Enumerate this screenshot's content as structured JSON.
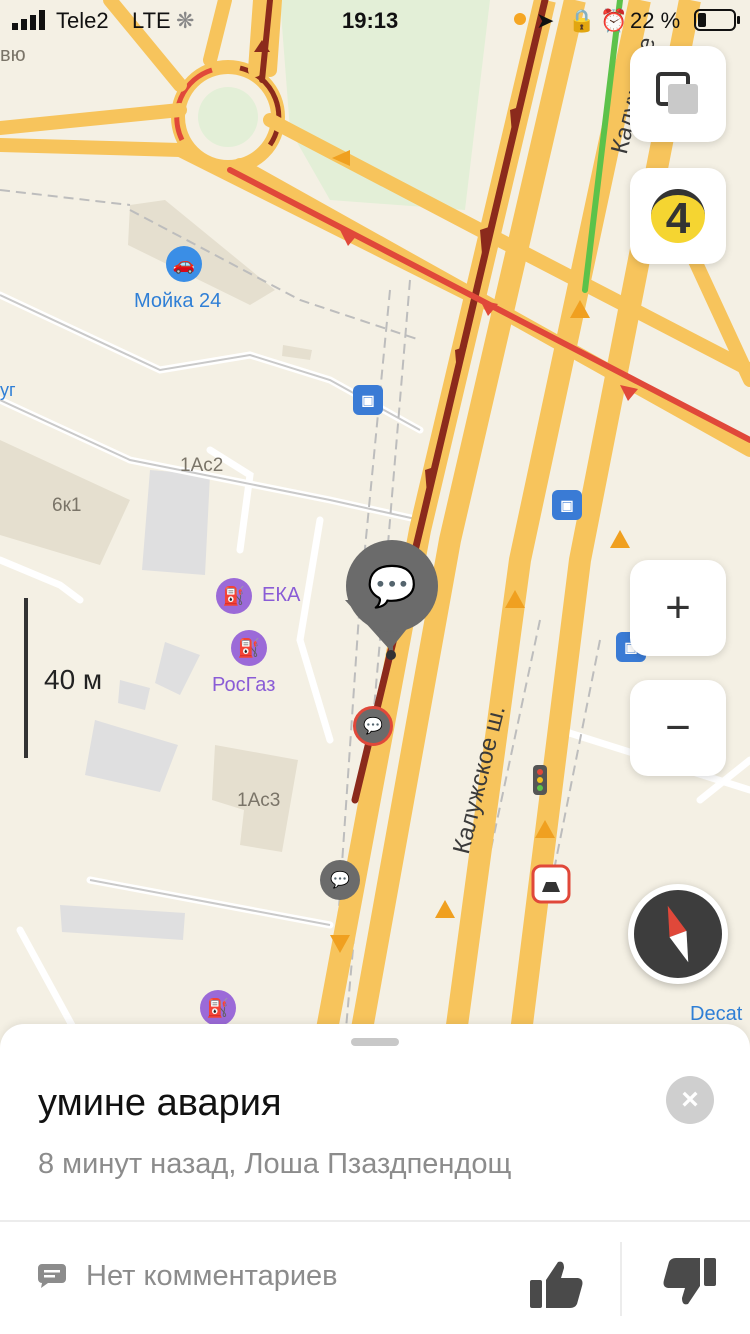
{
  "status_bar": {
    "carrier": "Tele2",
    "network": "LTE",
    "time": "19:13",
    "battery": "22 %"
  },
  "map": {
    "poi": {
      "carwash": "Мойка 24",
      "fuel_eka": "ЕКА",
      "fuel_rosgaz": "РосГаз",
      "decathlon": "Decat"
    },
    "buildings": {
      "b_6k1": "6к1",
      "b_1ac2": "1Ас2",
      "b_1ac3": "1Ас3"
    },
    "streets": {
      "kaluzhskoe_main": "Калужское ш.",
      "kaluzhskoe_top": "Калужское",
      "partial_top_left": "вю",
      "partial_left": "уг"
    },
    "traffic_level": "4",
    "scale": "40 м",
    "colors": {
      "traffic_heavy": "#8b2a1c",
      "traffic_red": "#e0483a",
      "traffic_free": "#5cc24a",
      "road_major": "#f7c45c",
      "traffic_badge": "#f5d531"
    }
  },
  "controls": {
    "zoom_in": "+",
    "zoom_out": "−"
  },
  "sheet": {
    "title": "умине авария",
    "meta": "8 минут назад, Лоша Пзаздпендощ",
    "comments": "Нет комментариев",
    "close": "×"
  }
}
